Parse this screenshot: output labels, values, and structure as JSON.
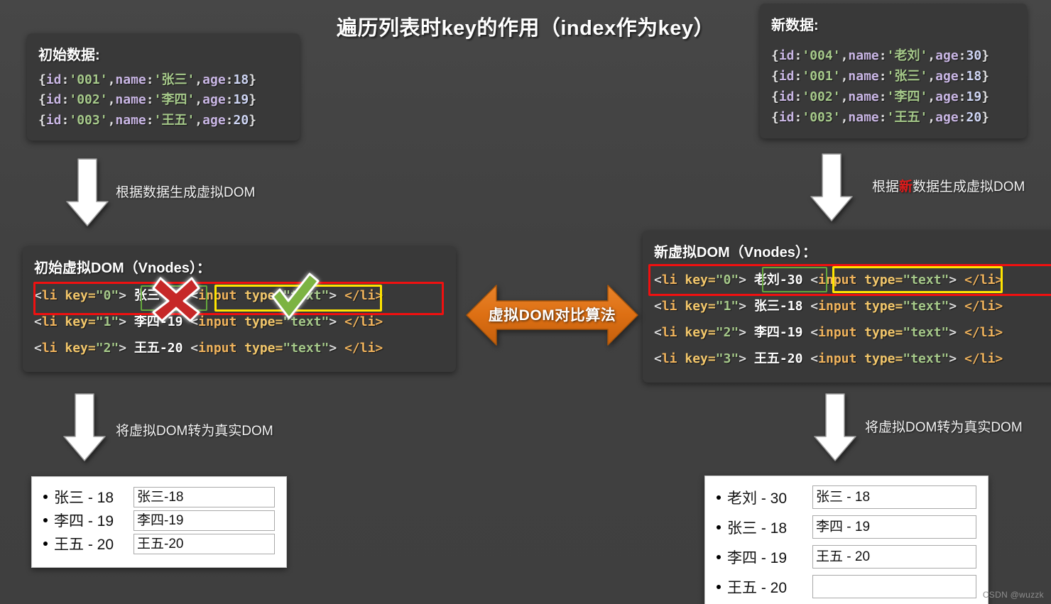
{
  "title": "遍历列表时key的作用（index作为key）",
  "watermark": "CSDN @wuzzk",
  "initial_data": {
    "heading": "初始数据:",
    "rows": [
      {
        "brace_open": "{",
        "k_id": "id",
        "c1": ":",
        "v_id": "'001'",
        "comma1": ",",
        "k_name": "name",
        "c2": ":",
        "v_name": "'张三'",
        "comma2": ",",
        "k_age": "age",
        "c3": ":",
        "v_age": "18",
        "brace_close": "}"
      },
      {
        "brace_open": "{",
        "k_id": "id",
        "c1": ":",
        "v_id": "'002'",
        "comma1": ",",
        "k_name": "name",
        "c2": ":",
        "v_name": "'李四'",
        "comma2": ",",
        "k_age": "age",
        "c3": ":",
        "v_age": "19",
        "brace_close": "}"
      },
      {
        "brace_open": "{",
        "k_id": "id",
        "c1": ":",
        "v_id": "'003'",
        "comma1": ",",
        "k_name": "name",
        "c2": ":",
        "v_name": "'王五'",
        "comma2": ",",
        "k_age": "age",
        "c3": ":",
        "v_age": "20",
        "brace_close": "}"
      }
    ]
  },
  "new_data": {
    "heading": "新数据:",
    "rows": [
      {
        "brace_open": "{",
        "k_id": "id",
        "c1": ":",
        "v_id": "'004'",
        "comma1": ",",
        "k_name": "name",
        "c2": ":",
        "v_name": "'老刘'",
        "comma2": ",",
        "k_age": "age",
        "c3": ":",
        "v_age": "30",
        "brace_close": "}"
      },
      {
        "brace_open": "{",
        "k_id": "id",
        "c1": ":",
        "v_id": "'001'",
        "comma1": ",",
        "k_name": "name",
        "c2": ":",
        "v_name": "'张三'",
        "comma2": ",",
        "k_age": "age",
        "c3": ":",
        "v_age": "18",
        "brace_close": "}"
      },
      {
        "brace_open": "{",
        "k_id": "id",
        "c1": ":",
        "v_id": "'002'",
        "comma1": ",",
        "k_name": "name",
        "c2": ":",
        "v_name": "'李四'",
        "comma2": ",",
        "k_age": "age",
        "c3": ":",
        "v_age": "19",
        "brace_close": "}"
      },
      {
        "brace_open": "{",
        "k_id": "id",
        "c1": ":",
        "v_id": "'003'",
        "comma1": ",",
        "k_name": "name",
        "c2": ":",
        "v_name": "'王五'",
        "comma2": ",",
        "k_age": "age",
        "c3": ":",
        "v_age": "20",
        "brace_close": "}"
      }
    ]
  },
  "initial_vdom": {
    "heading": "初始虚拟DOM（Vnodes）：",
    "rows": [
      {
        "lt": "<",
        "tag": "li",
        "attr": "key=",
        "keyval": "\"0\"",
        "gt": ">",
        "content": "张三-18",
        "lt2": "<",
        "tag2": "input",
        "attr2": "type=",
        "typeval": "\"text\"",
        "gt2": ">",
        "close": "</li>"
      },
      {
        "lt": "<",
        "tag": "li",
        "attr": "key=",
        "keyval": "\"1\"",
        "gt": ">",
        "content": "李四-19",
        "lt2": "<",
        "tag2": "input",
        "attr2": "type=",
        "typeval": "\"text\"",
        "gt2": ">",
        "close": "</li>"
      },
      {
        "lt": "<",
        "tag": "li",
        "attr": "key=",
        "keyval": "\"2\"",
        "gt": ">",
        "content": "王五-20",
        "lt2": "<",
        "tag2": "input",
        "attr2": "type=",
        "typeval": "\"text\"",
        "gt2": ">",
        "close": "</li>"
      }
    ]
  },
  "new_vdom": {
    "heading": "新虚拟DOM（Vnodes）：",
    "rows": [
      {
        "lt": "<",
        "tag": "li",
        "attr": "key=",
        "keyval": "\"0\"",
        "gt": ">",
        "content": "老刘-30",
        "lt2": "<",
        "tag2": "input",
        "attr2": "type=",
        "typeval": "\"text\"",
        "gt2": ">",
        "close": "</li>"
      },
      {
        "lt": "<",
        "tag": "li",
        "attr": "key=",
        "keyval": "\"1\"",
        "gt": ">",
        "content": "张三-18",
        "lt2": "<",
        "tag2": "input",
        "attr2": "type=",
        "typeval": "\"text\"",
        "gt2": ">",
        "close": "</li>"
      },
      {
        "lt": "<",
        "tag": "li",
        "attr": "key=",
        "keyval": "\"2\"",
        "gt": ">",
        "content": "李四-19",
        "lt2": "<",
        "tag2": "input",
        "attr2": "type=",
        "typeval": "\"text\"",
        "gt2": ">",
        "close": "</li>"
      },
      {
        "lt": "<",
        "tag": "li",
        "attr": "key=",
        "keyval": "\"3\"",
        "gt": ">",
        "content": "王五-20",
        "lt2": "<",
        "tag2": "input",
        "attr2": "type=",
        "typeval": "\"text\"",
        "gt2": ">",
        "close": "</li>"
      }
    ]
  },
  "arrows": {
    "left_top_label": "根据数据生成虚拟DOM",
    "right_top_label_pre": "根据",
    "right_top_label_hot": "新",
    "right_top_label_post": "数据生成虚拟DOM",
    "left_bottom_label": "将虚拟DOM转为真实DOM",
    "right_bottom_label": "将虚拟DOM转为真实DOM",
    "compare_label": "虚拟DOM对比算法"
  },
  "result_left": {
    "rows": [
      {
        "label": "张三 - 18",
        "input": "张三-18"
      },
      {
        "label": "李四 - 19",
        "input": "李四-19"
      },
      {
        "label": "王五 - 20",
        "input": "王五-20"
      }
    ]
  },
  "result_right": {
    "rows": [
      {
        "label": "老刘 - 30",
        "input": "张三 - 18"
      },
      {
        "label": "张三 - 18",
        "input": "李四 - 19"
      },
      {
        "label": "李四 - 19",
        "input": "王五 - 20"
      },
      {
        "label": "王五 - 20",
        "input": ""
      }
    ]
  },
  "colors": {
    "background": "#414141",
    "panel": "#393939",
    "accent_orange": "#e0761b",
    "highlight_red": "#f01010",
    "highlight_yellow": "#ffe400",
    "highlight_green": "#64a83c",
    "mark_cross_red": "#c62828",
    "mark_check_green": "#7cb342"
  }
}
